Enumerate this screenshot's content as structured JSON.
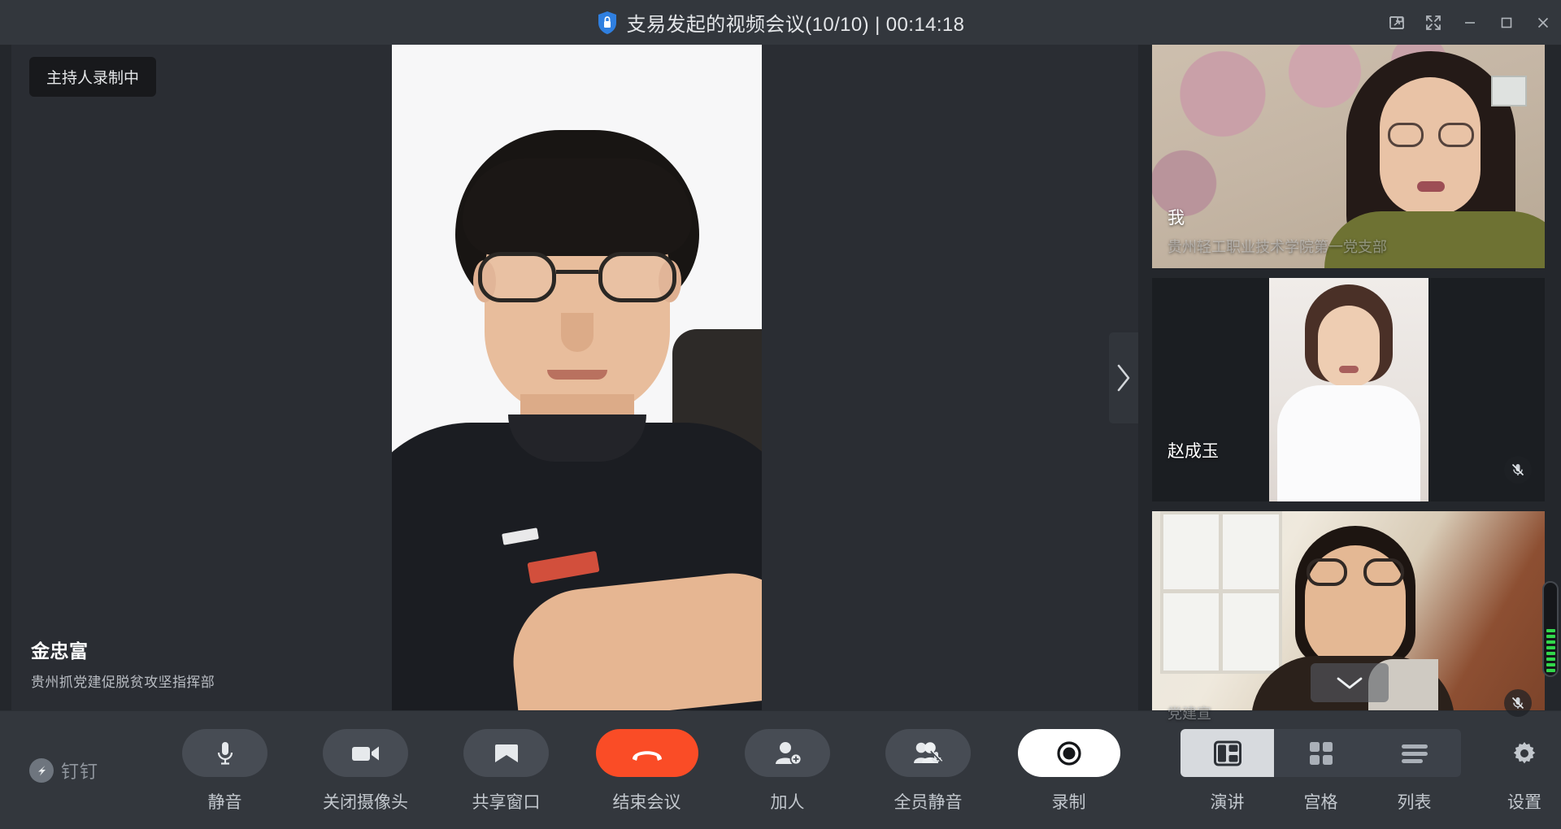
{
  "window": {
    "title": "支易发起的视频会议(10/10) | 00:14:18",
    "meeting_name": "支易发起的视频会议",
    "participant_count": "10/10",
    "elapsed": "00:14:18",
    "lock_icon": "lock-shield-icon",
    "controls": [
      {
        "name": "picture-in-picture",
        "icon": "pip-icon"
      },
      {
        "name": "fullscreen",
        "icon": "expand-icon"
      },
      {
        "name": "minimize",
        "icon": "minimize-icon"
      },
      {
        "name": "maximize",
        "icon": "maximize-icon"
      },
      {
        "name": "close",
        "icon": "close-icon"
      }
    ]
  },
  "stage": {
    "recording_badge": "主持人录制中",
    "speaker": {
      "name": "金忠富",
      "org": "贵州抓党建促脱贫攻坚指挥部"
    },
    "next_arrow_icon": "chevron-right-icon"
  },
  "sidebar": {
    "thumbnails": [
      {
        "label": "我",
        "org": "贵州轻工职业技术学院第一党支部",
        "muted": false
      },
      {
        "label": "赵成玉",
        "org": "",
        "muted": true,
        "mic_icon": "mic-off-icon"
      },
      {
        "label": "党建宣",
        "org": "",
        "muted": true,
        "mic_icon": "mic-off-icon"
      }
    ],
    "scroll_down_icon": "chevron-down-icon",
    "audio_meter_level": 8,
    "audio_meter_color": "#32d74b"
  },
  "toolbar": {
    "brand": "钉钉",
    "brand_icon": "dingtalk-logo-icon",
    "buttons": [
      {
        "label": "静音",
        "icon": "microphone-icon",
        "style": "normal"
      },
      {
        "label": "关闭摄像头",
        "icon": "camera-icon",
        "style": "normal"
      },
      {
        "label": "共享窗口",
        "icon": "share-screen-icon",
        "style": "normal"
      },
      {
        "label": "结束会议",
        "icon": "hangup-icon",
        "style": "danger"
      },
      {
        "label": "加人",
        "icon": "add-person-icon",
        "style": "normal"
      },
      {
        "label": "全员静音",
        "icon": "mute-all-icon",
        "style": "normal"
      },
      {
        "label": "录制",
        "icon": "record-icon",
        "style": "white"
      }
    ],
    "view_modes": [
      {
        "label": "演讲",
        "icon": "speaker-view-icon",
        "active": true
      },
      {
        "label": "宫格",
        "icon": "grid-view-icon",
        "active": false
      },
      {
        "label": "列表",
        "icon": "list-view-icon",
        "active": false
      }
    ],
    "settings": {
      "label": "设置",
      "icon": "gear-icon"
    }
  },
  "colors": {
    "titlebar": "#33373d",
    "stage": "#24272c",
    "danger": "#fa4c26",
    "accent_active": "#d7dade"
  }
}
